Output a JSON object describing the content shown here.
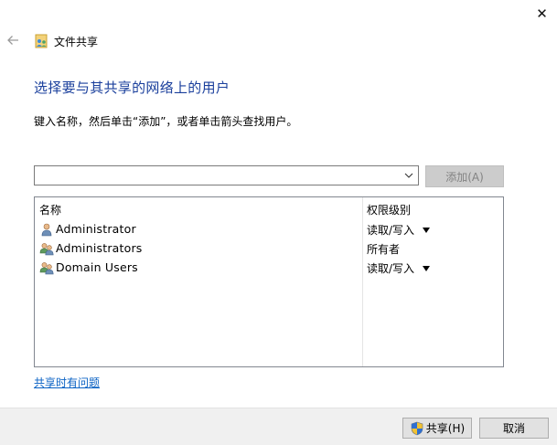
{
  "window": {
    "title": "文件共享",
    "close_glyph": "✕"
  },
  "main": {
    "heading": "选择要与其共享的网络上的用户",
    "instruction": "键入名称，然后单击“添加”，或者单击箭头查找用户。",
    "combo_value": "",
    "add_button": "添加(A)"
  },
  "table": {
    "headers": {
      "name": "名称",
      "permission": "权限级别"
    },
    "rows": [
      {
        "name": "Administrator",
        "permission": "读取/写入",
        "icon": "user-icon",
        "has_dropdown": true
      },
      {
        "name": "Administrators",
        "permission": "所有者",
        "icon": "users-group-icon",
        "has_dropdown": false
      },
      {
        "name": "Domain Users",
        "permission": "读取/写入",
        "icon": "users-group-icon",
        "has_dropdown": true
      }
    ]
  },
  "footer": {
    "help_link": "共享时有问题",
    "share_button": "共享(H)",
    "cancel_button": "取消"
  },
  "colors": {
    "heading": "#1a3f9c",
    "link": "#0a62c4",
    "disabled_button_bg": "#cccccc",
    "footer_bg": "#f0f0f0"
  }
}
